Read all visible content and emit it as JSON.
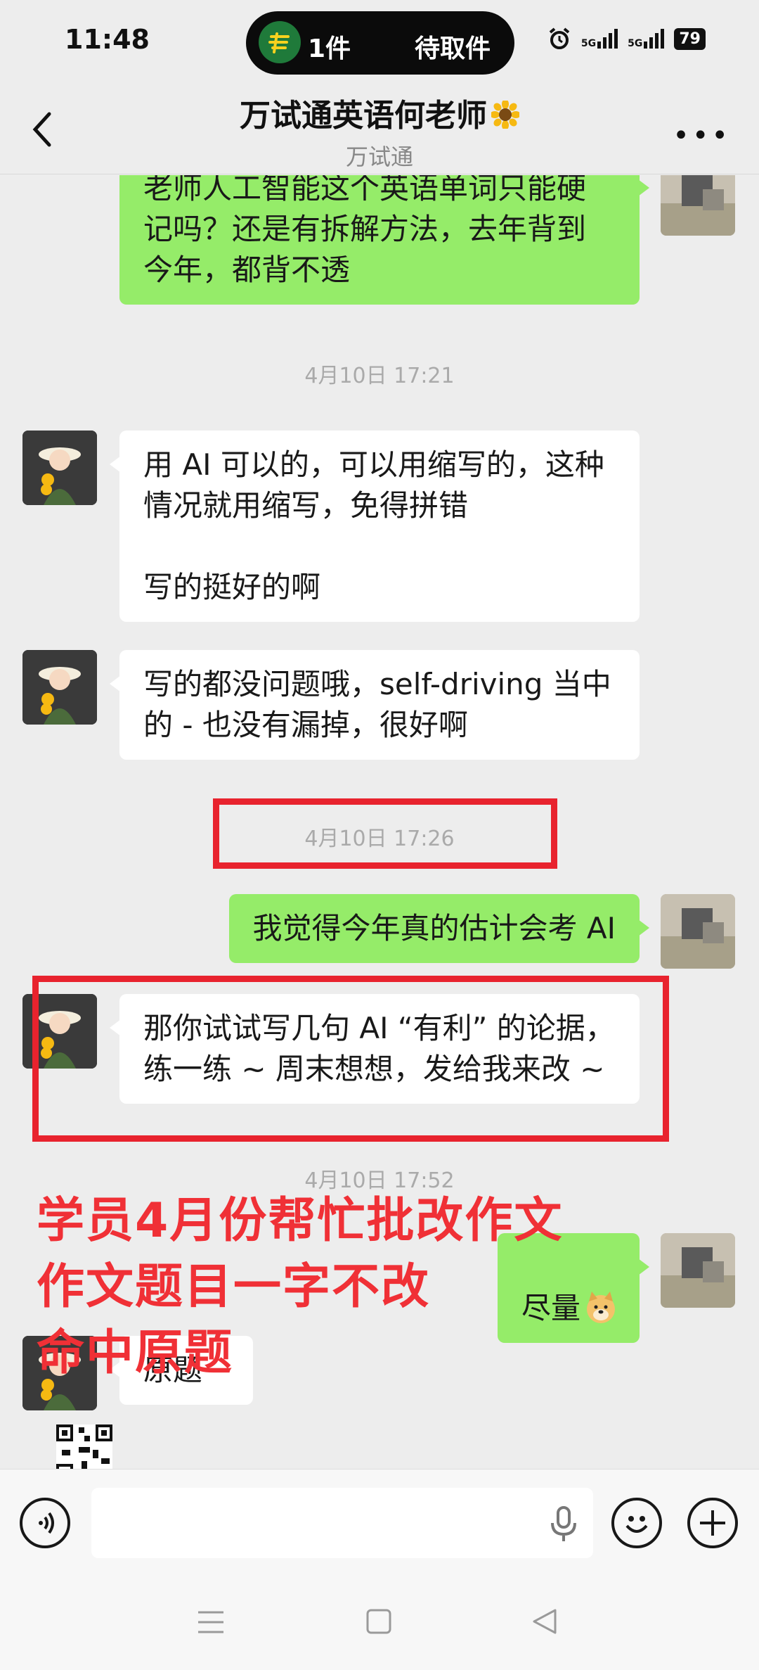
{
  "status_bar": {
    "time": "11:48",
    "island_count": "1件",
    "island_status": "待取件",
    "net1": "5G",
    "net2": "5G",
    "battery": "79"
  },
  "header": {
    "title": "万试通英语何老师",
    "subtitle": "万试通",
    "back_icon": "chevron-left-icon",
    "more_icon": "more-dots-icon"
  },
  "messages": [
    {
      "side": "out",
      "text": "老师人工智能这个英语单词只能硬\n记吗？还是有拆解方法，去年背到\n今年，都背不透"
    },
    {
      "type": "time",
      "text": "4月10日 17:21"
    },
    {
      "side": "in",
      "text": "用 AI 可以的，可以用缩写的，这种\n情况就用缩写，免得拼错\n\n写的挺好的啊"
    },
    {
      "side": "in",
      "text": "写的都没问题哦，self-driving 当中\n的 - 也没有漏掉，很好啊"
    },
    {
      "type": "time",
      "text": "4月10日 17:26"
    },
    {
      "side": "out",
      "text": "我觉得今年真的估计会考 AI"
    },
    {
      "side": "in",
      "text": "那你试试写几句 AI “有利” 的论据，\n练一练 ~ 周末想想，发给我来改 ~"
    },
    {
      "type": "time",
      "text": "4月10日 17:52"
    },
    {
      "side": "out",
      "text": "尽量"
    },
    {
      "side": "in",
      "text": "原题"
    }
  ],
  "overlay": {
    "line1": "学员4月份帮忙批改作文",
    "line2": "作文题目一字不改",
    "line3": "命中原题"
  },
  "input_bar": {
    "voice_icon": "voice-toggle-icon",
    "mic_icon": "microphone-icon",
    "emoji_icon": "emoji-icon",
    "plus_icon": "plus-icon"
  },
  "colors": {
    "outgoing_bubble": "#95ec69",
    "incoming_bubble": "#ffffff",
    "highlight": "#e8232e",
    "background": "#ededed"
  }
}
